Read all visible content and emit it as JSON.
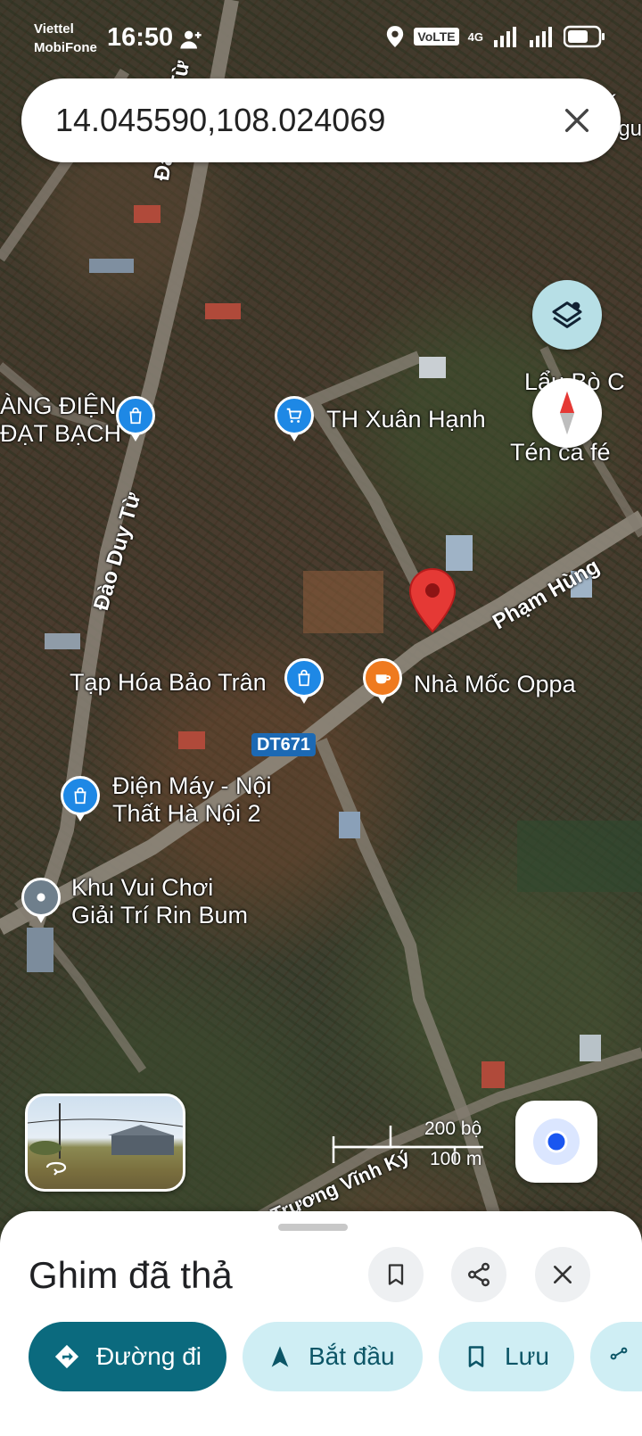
{
  "status_bar": {
    "carrier_1": "Viettel",
    "carrier_2": "MobiFone",
    "time": "16:50",
    "volte": "VoLTE",
    "network": "4G"
  },
  "search": {
    "value": "14.045590,108.024069"
  },
  "map": {
    "roads": [
      {
        "name": "Đào Duy Từ"
      },
      {
        "name": "Đào Duy Từ"
      },
      {
        "name": "Phạm Hùng"
      },
      {
        "name": "DT671"
      },
      {
        "name": "Trương Vĩnh Ký"
      }
    ],
    "places": [
      {
        "name": "ÀNG ĐIỆN\nĐẠT BẠCH",
        "category": "shopping"
      },
      {
        "name": "TH Xuân Hạnh",
        "category": "grocery"
      },
      {
        "name": "Lẩu Bò C",
        "category": "restaurant"
      },
      {
        "name": "Tén ca fé",
        "category": "cafe"
      },
      {
        "name": "Tạp Hóa Bảo Trân",
        "category": "shopping"
      },
      {
        "name": "Nhà Mốc Oppa",
        "category": "cafe"
      },
      {
        "name": "Điện Máy - Nội\nThất Hà Nội 2",
        "category": "shopping"
      },
      {
        "name": "Khu Vui Chơi\nGiải Trí Rin Bum",
        "category": "place"
      },
      {
        "name": "K\nNguy",
        "category": "place"
      }
    ],
    "scale": {
      "imperial": "200 bộ",
      "metric": "100 m"
    }
  },
  "bottom_sheet": {
    "title": "Ghim đã thả",
    "actions": {
      "directions": "Đường đi",
      "start": "Bắt đầu",
      "save": "Lưu"
    }
  },
  "icons": {
    "clear": "close-icon",
    "layers": "layers-icon",
    "compass": "compass-icon",
    "my_location": "my-location-icon",
    "bookmark": "bookmark-icon",
    "share": "share-icon",
    "close": "close-icon",
    "directions": "directions-icon",
    "navigation": "navigation-arrow-icon"
  },
  "colors": {
    "primary": "#0b6a7e",
    "chip_light": "#cfeef4",
    "pin_red": "#e53935",
    "poi_blue": "#1e88e5",
    "poi_orange": "#ef7a1f"
  }
}
